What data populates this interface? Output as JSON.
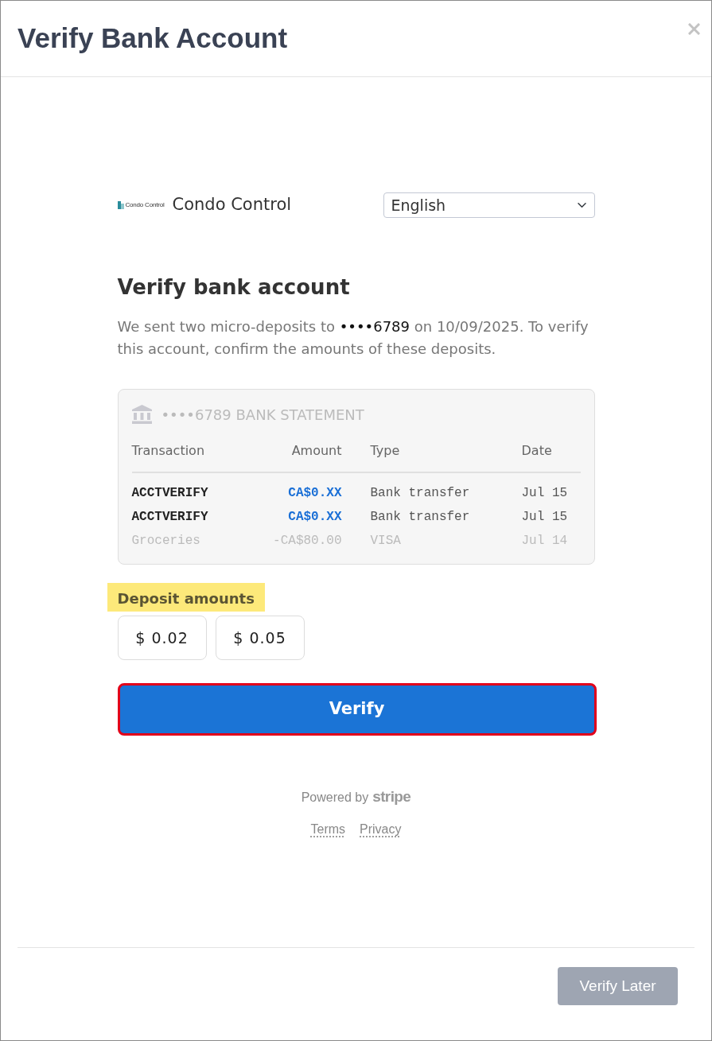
{
  "modal": {
    "title": "Verify Bank Account"
  },
  "merchant": {
    "logo_text": "Condo Control",
    "name": "Condo Control"
  },
  "language_select": {
    "value": "English"
  },
  "heading": "Verify bank account",
  "description": {
    "text_before": "We sent two micro-deposits to ",
    "account": "••••6789",
    "text_after": " on 10/09/2025. To verify this account, confirm the amounts of these deposits."
  },
  "statement": {
    "title": "••••6789 BANK STATEMENT",
    "columns": [
      "Transaction",
      "Amount",
      "Type",
      "Date"
    ],
    "rows": [
      {
        "kind": "microdeposit",
        "cells": [
          "ACCTVERIFY",
          "CA$0.XX",
          "Bank transfer",
          "Jul 15"
        ]
      },
      {
        "kind": "microdeposit",
        "cells": [
          "ACCTVERIFY",
          "CA$0.XX",
          "Bank transfer",
          "Jul 15"
        ]
      },
      {
        "kind": "regular",
        "cells": [
          "Groceries",
          "-CA$80.00",
          "VISA",
          "Jul 14"
        ]
      }
    ]
  },
  "deposit_amounts": {
    "label": "Deposit amounts",
    "highlighted": true,
    "fields": [
      {
        "value": "$ 0.02"
      },
      {
        "value": "$ 0.05"
      }
    ]
  },
  "verify_button": {
    "label": "Verify",
    "highlighted": true
  },
  "powered_by": {
    "prefix": "Powered by",
    "brand": "stripe"
  },
  "links": [
    "Terms",
    "Privacy"
  ],
  "footer_button": {
    "label": "Verify Later",
    "disabled": true
  }
}
